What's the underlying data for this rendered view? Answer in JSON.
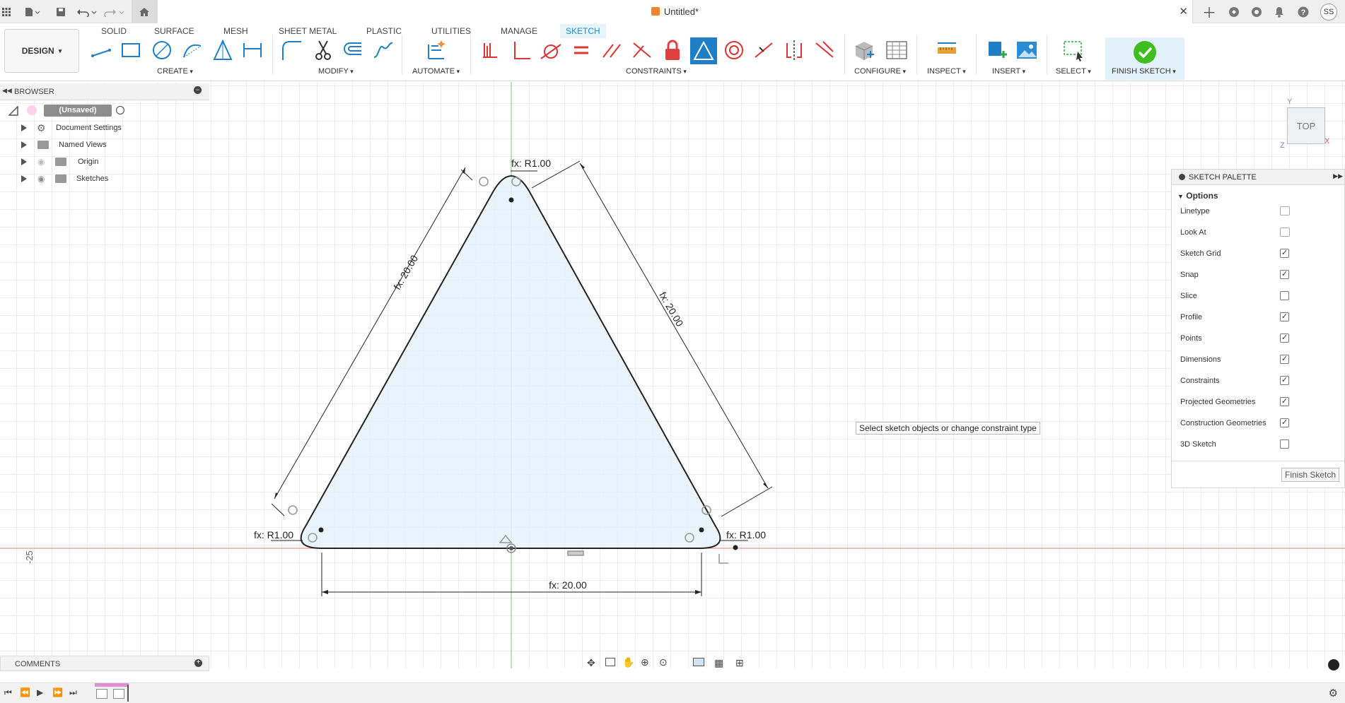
{
  "title_bar": {
    "doc_title": "Untitled*",
    "user_initials": "SS"
  },
  "ribbon": {
    "design_label": "DESIGN",
    "tabs": [
      "SOLID",
      "SURFACE",
      "MESH",
      "SHEET METAL",
      "PLASTIC",
      "UTILITIES",
      "MANAGE",
      "SKETCH"
    ],
    "active_tab": "SKETCH",
    "groups": [
      "CREATE",
      "MODIFY",
      "AUTOMATE",
      "CONSTRAINTS",
      "CONFIGURE",
      "INSPECT",
      "INSERT",
      "SELECT",
      "FINISH SKETCH"
    ]
  },
  "browser": {
    "title": "BROWSER",
    "root": "(Unsaved)",
    "items": [
      "Document Settings",
      "Named Views",
      "Origin",
      "Sketches"
    ]
  },
  "comments": {
    "title": "COMMENTS"
  },
  "sketch": {
    "dim_left": "fx: 20.00",
    "dim_right": "fx: 20.00",
    "dim_bottom": "fx: 20.00",
    "radius_top": "fx: R1.00",
    "radius_left": "fx: R1.00",
    "radius_right": "fx: R1.00",
    "axis_label": "-25"
  },
  "viewcube": {
    "face": "TOP",
    "axis_y": "Y",
    "axis_x": "X",
    "axis_z": "Z"
  },
  "tooltip": "Select sketch objects or change constraint type",
  "palette": {
    "title": "SKETCH PALETTE",
    "section": "Options",
    "rows": [
      {
        "label": "Linetype",
        "kind": "icon"
      },
      {
        "label": "Look At",
        "kind": "icon"
      },
      {
        "label": "Sketch Grid",
        "kind": "check",
        "checked": true
      },
      {
        "label": "Snap",
        "kind": "check",
        "checked": true
      },
      {
        "label": "Slice",
        "kind": "check",
        "checked": false
      },
      {
        "label": "Profile",
        "kind": "check",
        "checked": true
      },
      {
        "label": "Points",
        "kind": "check",
        "checked": true
      },
      {
        "label": "Dimensions",
        "kind": "check",
        "checked": true
      },
      {
        "label": "Constraints",
        "kind": "check",
        "checked": true
      },
      {
        "label": "Projected Geometries",
        "kind": "check",
        "checked": true
      },
      {
        "label": "Construction Geometries",
        "kind": "check",
        "checked": true
      },
      {
        "label": "3D Sketch",
        "kind": "check",
        "checked": false
      }
    ],
    "finish_button": "Finish Sketch"
  },
  "colors": {
    "accent": "#0696d7",
    "finish_green": "#3fbf1f",
    "axis_red": "#e07b7b",
    "axis_green": "#7ecb7e",
    "profile_fill": "#e4f1fb"
  }
}
